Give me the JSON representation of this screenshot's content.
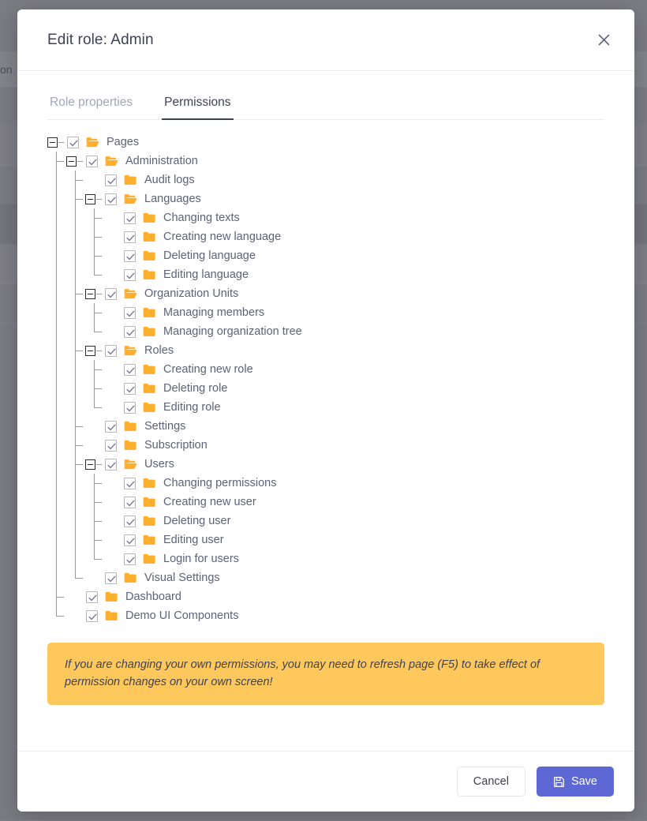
{
  "backdrop": {
    "visible_text": "on"
  },
  "modal": {
    "title": "Edit role: Admin",
    "close_icon": "close-icon",
    "tabs": [
      {
        "label": "Role properties",
        "active": false
      },
      {
        "label": "Permissions",
        "active": true
      }
    ],
    "warning": "If you are changing your own permissions, you may need to refresh page (F5) to take effect of permission changes on your own screen!",
    "footer": {
      "cancel_label": "Cancel",
      "save_label": "Save",
      "save_icon": "save-floppy-icon"
    }
  },
  "colors": {
    "accent_save": "#5d68d4",
    "folder": "#ffaf2e",
    "warning_bg": "#ffc85c",
    "backdrop": "#7b7b82",
    "text": "#5e6278",
    "tab_inactive": "#a1a5b7"
  },
  "tree": {
    "nodes": [
      {
        "label": "Pages",
        "level": 0,
        "expandable": true,
        "expanded": true,
        "checked": true,
        "last": false
      },
      {
        "label": "Administration",
        "level": 1,
        "expandable": true,
        "expanded": true,
        "checked": true,
        "last": false
      },
      {
        "label": "Audit logs",
        "level": 2,
        "expandable": false,
        "expanded": false,
        "checked": true,
        "last": false
      },
      {
        "label": "Languages",
        "level": 2,
        "expandable": true,
        "expanded": true,
        "checked": true,
        "last": false
      },
      {
        "label": "Changing texts",
        "level": 3,
        "expandable": false,
        "expanded": false,
        "checked": true,
        "last": false
      },
      {
        "label": "Creating new language",
        "level": 3,
        "expandable": false,
        "expanded": false,
        "checked": true,
        "last": false
      },
      {
        "label": "Deleting language",
        "level": 3,
        "expandable": false,
        "expanded": false,
        "checked": true,
        "last": false
      },
      {
        "label": "Editing language",
        "level": 3,
        "expandable": false,
        "expanded": false,
        "checked": true,
        "last": true
      },
      {
        "label": "Organization Units",
        "level": 2,
        "expandable": true,
        "expanded": true,
        "checked": true,
        "last": false
      },
      {
        "label": "Managing members",
        "level": 3,
        "expandable": false,
        "expanded": false,
        "checked": true,
        "last": false
      },
      {
        "label": "Managing organization tree",
        "level": 3,
        "expandable": false,
        "expanded": false,
        "checked": true,
        "last": true
      },
      {
        "label": "Roles",
        "level": 2,
        "expandable": true,
        "expanded": true,
        "checked": true,
        "last": false
      },
      {
        "label": "Creating new role",
        "level": 3,
        "expandable": false,
        "expanded": false,
        "checked": true,
        "last": false
      },
      {
        "label": "Deleting role",
        "level": 3,
        "expandable": false,
        "expanded": false,
        "checked": true,
        "last": false
      },
      {
        "label": "Editing role",
        "level": 3,
        "expandable": false,
        "expanded": false,
        "checked": true,
        "last": true
      },
      {
        "label": "Settings",
        "level": 2,
        "expandable": false,
        "expanded": false,
        "checked": true,
        "last": false
      },
      {
        "label": "Subscription",
        "level": 2,
        "expandable": false,
        "expanded": false,
        "checked": true,
        "last": false
      },
      {
        "label": "Users",
        "level": 2,
        "expandable": true,
        "expanded": true,
        "checked": true,
        "last": false
      },
      {
        "label": "Changing permissions",
        "level": 3,
        "expandable": false,
        "expanded": false,
        "checked": true,
        "last": false
      },
      {
        "label": "Creating new user",
        "level": 3,
        "expandable": false,
        "expanded": false,
        "checked": true,
        "last": false
      },
      {
        "label": "Deleting user",
        "level": 3,
        "expandable": false,
        "expanded": false,
        "checked": true,
        "last": false
      },
      {
        "label": "Editing user",
        "level": 3,
        "expandable": false,
        "expanded": false,
        "checked": true,
        "last": false
      },
      {
        "label": "Login for users",
        "level": 3,
        "expandable": false,
        "expanded": false,
        "checked": true,
        "last": true
      },
      {
        "label": "Visual Settings",
        "level": 2,
        "expandable": false,
        "expanded": false,
        "checked": true,
        "last": true
      },
      {
        "label": "Dashboard",
        "level": 1,
        "expandable": false,
        "expanded": false,
        "checked": true,
        "last": false
      },
      {
        "label": "Demo UI Components",
        "level": 1,
        "expandable": false,
        "expanded": false,
        "checked": true,
        "last": true
      }
    ]
  }
}
